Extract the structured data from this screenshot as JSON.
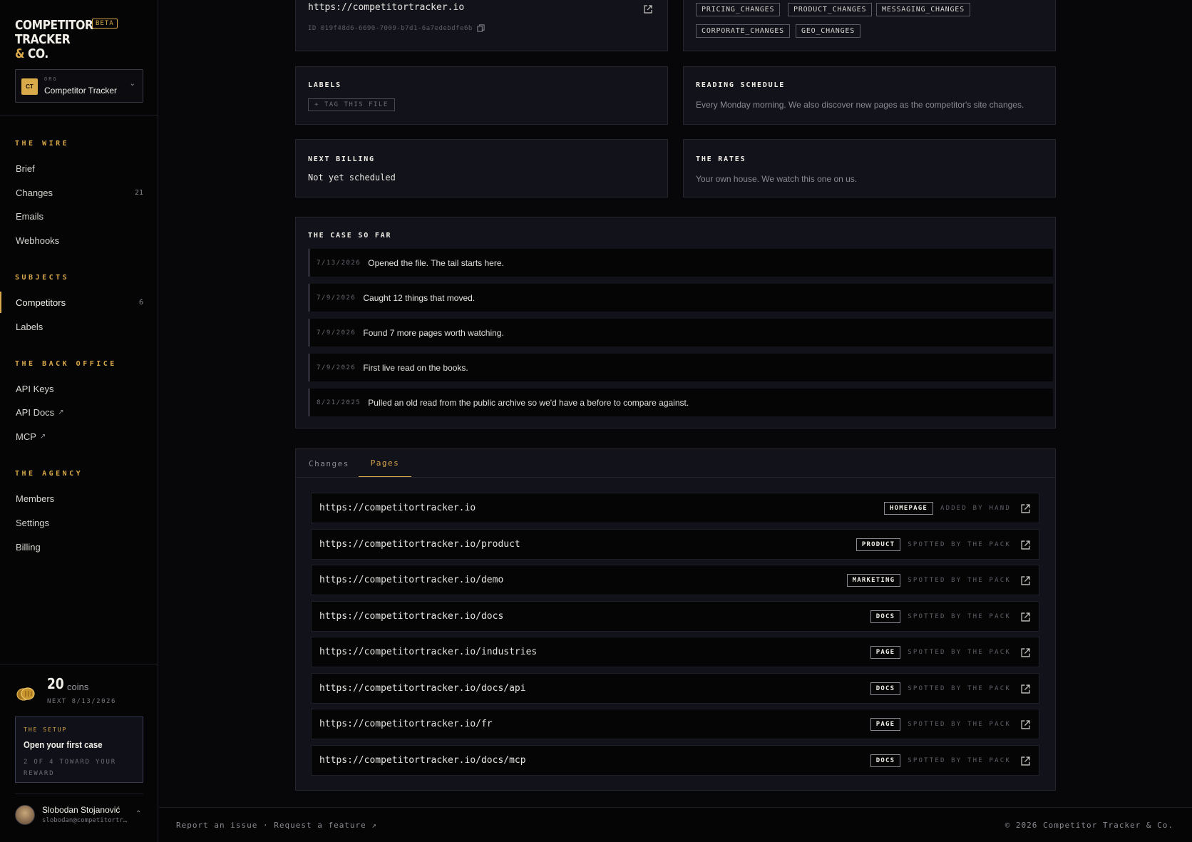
{
  "brand": {
    "line1": "COMPETITOR",
    "line2": "TRACKER",
    "line3_amp": "&",
    "line3_rest": "CO.",
    "badge": "BETA"
  },
  "org": {
    "initials": "CT",
    "kicker": "ORG",
    "name": "Competitor Tracker"
  },
  "nav": {
    "sections": [
      {
        "title": "THE WIRE",
        "items": [
          {
            "label": "Brief"
          },
          {
            "label": "Changes",
            "count": "21"
          },
          {
            "label": "Emails"
          },
          {
            "label": "Webhooks"
          }
        ]
      },
      {
        "title": "SUBJECTS",
        "items": [
          {
            "label": "Competitors",
            "count": "6",
            "active": true
          },
          {
            "label": "Labels"
          }
        ]
      },
      {
        "title": "THE BACK OFFICE",
        "items": [
          {
            "label": "API Keys"
          },
          {
            "label": "API Docs",
            "external": true
          },
          {
            "label": "MCP",
            "external": true
          }
        ]
      },
      {
        "title": "THE AGENCY",
        "items": [
          {
            "label": "Members"
          },
          {
            "label": "Settings"
          },
          {
            "label": "Billing"
          }
        ]
      }
    ]
  },
  "coins": {
    "amount": "20",
    "unit": "coins",
    "next": "NEXT 8/13/2026"
  },
  "setup": {
    "kicker": "THE SETUP",
    "title": "Open your first case",
    "subtitle": "2 OF 4 TOWARD YOUR REWARD"
  },
  "user": {
    "name": "Slobodan Stojanović",
    "email": "slobodan@competitortr…"
  },
  "overview": {
    "url": "https://competitortracker.io",
    "id": "ID 019f48d6-6690-7009-b7d1-6a7edebdfe6b",
    "monitors": [
      "PRICING_CHANGES",
      "PRODUCT_CHANGES",
      "MESSAGING_CHANGES",
      "CORPORATE_CHANGES",
      "GEO_CHANGES"
    ]
  },
  "labels": {
    "title": "LABELS",
    "button": "+ TAG THIS FILE"
  },
  "schedule": {
    "title": "READING SCHEDULE",
    "text": "Every Monday morning. We also discover new pages as the competitor's site changes."
  },
  "billing": {
    "title": "NEXT BILLING",
    "value": "Not yet scheduled"
  },
  "rates": {
    "title": "THE RATES",
    "text": "Your own house. We watch this one on us."
  },
  "case": {
    "title": "THE CASE SO FAR",
    "events": [
      {
        "date": "7/13/2026",
        "text": "Opened the file. The tail starts here."
      },
      {
        "date": "7/9/2026",
        "text": "Caught 12 things that moved."
      },
      {
        "date": "7/9/2026",
        "text": "Found 7 more pages worth watching."
      },
      {
        "date": "7/9/2026",
        "text": "First live read on the books."
      },
      {
        "date": "8/21/2025",
        "text": "Pulled an old read from the public archive so we'd have a before to compare against."
      }
    ]
  },
  "tabs": [
    {
      "label": "Changes"
    },
    {
      "label": "Pages",
      "active": true
    }
  ],
  "pages": [
    {
      "url": "https://competitortracker.io",
      "type": "HOMEPAGE",
      "source": "ADDED BY HAND"
    },
    {
      "url": "https://competitortracker.io/product",
      "type": "PRODUCT",
      "source": "SPOTTED BY THE PACK"
    },
    {
      "url": "https://competitortracker.io/demo",
      "type": "MARKETING",
      "source": "SPOTTED BY THE PACK"
    },
    {
      "url": "https://competitortracker.io/docs",
      "type": "DOCS",
      "source": "SPOTTED BY THE PACK"
    },
    {
      "url": "https://competitortracker.io/industries",
      "type": "PAGE",
      "source": "SPOTTED BY THE PACK"
    },
    {
      "url": "https://competitortracker.io/docs/api",
      "type": "DOCS",
      "source": "SPOTTED BY THE PACK"
    },
    {
      "url": "https://competitortracker.io/fr",
      "type": "PAGE",
      "source": "SPOTTED BY THE PACK"
    },
    {
      "url": "https://competitortracker.io/docs/mcp",
      "type": "DOCS",
      "source": "SPOTTED BY THE PACK"
    }
  ],
  "footer": {
    "report": "Report an issue",
    "sep": "·",
    "request": "Request a feature ↗",
    "copyright": "© 2026 Competitor Tracker & Co."
  },
  "colors": {
    "accent": "#d9a94a",
    "bg": "#07070a",
    "card": "#12121a"
  }
}
